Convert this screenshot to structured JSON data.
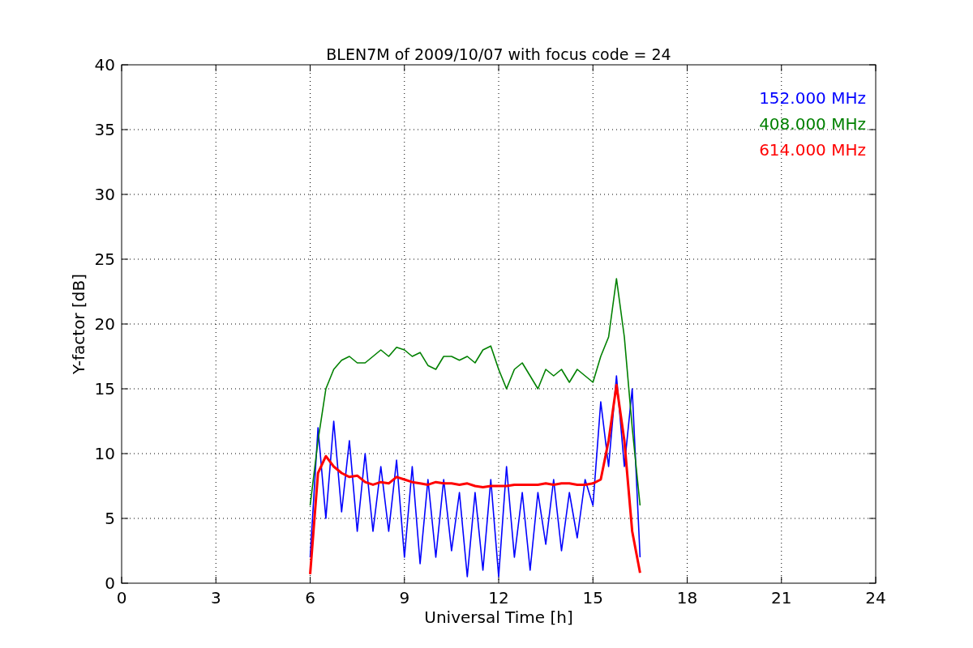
{
  "figure": {
    "chart_data": {
      "type": "line",
      "title": "BLEN7M of 2009/10/07 with focus code = 24",
      "xlabel": "Universal Time [h]",
      "ylabel": "Y-factor [dB]",
      "xlim": [
        0,
        24
      ],
      "ylim": [
        0,
        40
      ],
      "xticks": [
        0,
        3,
        6,
        9,
        12,
        15,
        18,
        21,
        24
      ],
      "yticks": [
        0,
        5,
        10,
        15,
        20,
        25,
        30,
        35,
        40
      ],
      "grid": true,
      "x": [
        6,
        6.25,
        6.5,
        6.75,
        7,
        7.25,
        7.5,
        7.75,
        8,
        8.25,
        8.5,
        8.75,
        9,
        9.25,
        9.5,
        9.75,
        10,
        10.25,
        10.5,
        10.75,
        11,
        11.25,
        11.5,
        11.75,
        12,
        12.25,
        12.5,
        12.75,
        13,
        13.25,
        13.5,
        13.75,
        14,
        14.25,
        14.5,
        14.75,
        15,
        15.25,
        15.5,
        15.75,
        16,
        16.25,
        16.5
      ],
      "series": [
        {
          "name": "152.000 MHz",
          "color": "#0000ff",
          "values": [
            2,
            12,
            5,
            12.5,
            5.5,
            11,
            4,
            10,
            4,
            9,
            4,
            9.5,
            2,
            9,
            1.5,
            8,
            2,
            8,
            2.5,
            7,
            0.5,
            7,
            1,
            8,
            0.5,
            9,
            2,
            7,
            1,
            7,
            3,
            8,
            2.5,
            7,
            3.5,
            8,
            6,
            14,
            9,
            16,
            9,
            15,
            2
          ]
        },
        {
          "name": "408.000 MHz",
          "color": "#008000",
          "values": [
            6,
            11,
            15,
            16.5,
            17.2,
            17.5,
            17,
            17,
            17.5,
            18,
            17.5,
            18.2,
            18,
            17.5,
            17.8,
            16.8,
            16.5,
            17.5,
            17.5,
            17.2,
            17.5,
            17,
            18,
            18.3,
            16.5,
            15,
            16.5,
            17,
            16,
            15,
            16.5,
            16,
            16.5,
            15.5,
            16.5,
            16,
            15.5,
            17.5,
            19,
            23.5,
            19,
            12,
            6
          ]
        },
        {
          "name": "614.000 MHz",
          "color": "#ff0000",
          "values": [
            0.7,
            8.5,
            9.8,
            9,
            8.5,
            8.2,
            8.3,
            7.8,
            7.6,
            7.8,
            7.7,
            8.2,
            8,
            7.8,
            7.7,
            7.6,
            7.8,
            7.7,
            7.7,
            7.6,
            7.7,
            7.5,
            7.4,
            7.5,
            7.5,
            7.5,
            7.6,
            7.6,
            7.6,
            7.6,
            7.7,
            7.6,
            7.7,
            7.7,
            7.6,
            7.6,
            7.7,
            8,
            11,
            15.3,
            11,
            4,
            0.8
          ]
        }
      ]
    }
  }
}
